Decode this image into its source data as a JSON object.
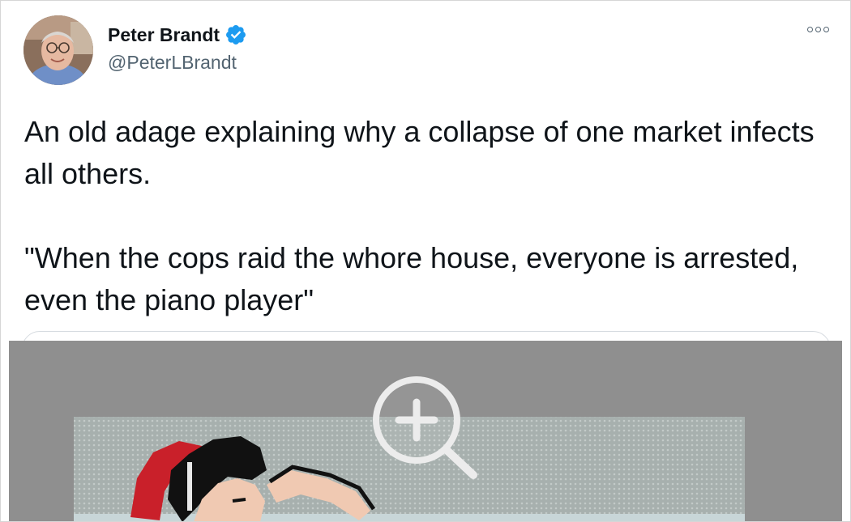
{
  "tweet": {
    "author": {
      "display_name": "Peter Brandt",
      "handle": "@PeterLBrandt",
      "verified": true,
      "avatar_icon": "profile-photo"
    },
    "more_icon": "more-options-icon",
    "text": "An old adage explaining why a collapse of one market infects all others.\n\n\"When the cops raid the whore house, everyone is arrested, even the piano player\"",
    "media": {
      "type": "photo",
      "overlay_icon": "zoom-in-icon"
    }
  },
  "colors": {
    "text_primary": "#0f1419",
    "text_secondary": "#536471",
    "verified_badge": "#1d9bf0",
    "image_background": "#8f8f8f"
  }
}
